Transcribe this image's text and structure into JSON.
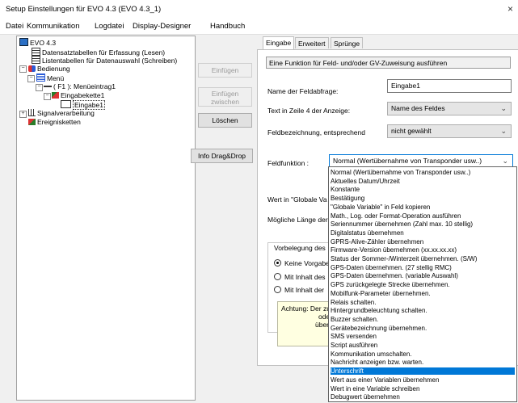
{
  "window": {
    "title": "Setup Einstellungen für EVO 4.3    (EVO 4.3_1)",
    "close_glyph": "×"
  },
  "menu": [
    "Datei",
    "Kommunikation",
    "Logdatei",
    "Display-Designer",
    "Handbuch"
  ],
  "tree": {
    "root": "EVO 4.3",
    "items": [
      "Datensatztabellen für Erfassung (Lesen)",
      "Listentabellen für Datenauswahl (Schreiben)",
      "Bedienung",
      "Menü",
      "( F1 ): Menüeintrag1",
      "Eingabekette1",
      "Eingabe1",
      "Signalverarbeitung",
      "Ereignisketten"
    ]
  },
  "buttons": {
    "einfuegen": "Einfügen",
    "einfuegen_zwischen": "Einfügen zwischen",
    "loeschen": "Löschen",
    "info_dragdrop": "Info Drag&Drop"
  },
  "tabs": [
    "Eingabe",
    "Erweitert",
    "Sprünge"
  ],
  "form": {
    "heading": "Eine Funktion für Feld- und/oder GV-Zuweisung ausführen",
    "name_label": "Name der Feldabfrage:",
    "name_value": "Eingabe1",
    "text_label": "Text in Zeile 4 der Anzeige:",
    "text_value": "Name des Feldes",
    "bez_label": "Feldbezeichnung, entsprechend",
    "bez_value": "nicht gewählt",
    "funktion_label": "Feldfunktion :",
    "funktion_value": "Normal (Wertübernahme von Transponder usw..)",
    "wert_label": "Wert in \"Globale Va",
    "laenge_label": "Mögliche Länge der",
    "vorbelegung_label": "Vorbelegung des",
    "radio1": "Keine Vorgabe",
    "radio2": "Mit Inhalt des",
    "radio3": "Mit Inhalt der",
    "note_lines": [
      "Achtung: Der zu",
      "oder d",
      "übersc"
    ]
  },
  "dropdown_options": [
    "Normal (Wertübernahme von Transponder usw..)",
    "Aktuelles Datum/Uhrzeit",
    "Konstante",
    "Bestätigung",
    "\"Globale Variable\" in Feld kopieren",
    "Math., Log. oder Format-Operation ausführen",
    "Seriennummer übernehmen (Zahl max. 10 stellig)",
    "Digitalstatus übernehmen",
    "GPRS-Alive-Zähler übernehmen",
    "Firmware-Version übernehmen (xx.xx.xx.xx)",
    "Status der Sommer-/Winterzeit übernehmen. (S/W)",
    "GPS-Daten übernehmen. (27 stellig RMC)",
    "GPS-Daten übernehmen. (variable Auswahl)",
    "GPS zurückgelegte Strecke übernehmen.",
    "Mobilfunk-Parameter übernehmen.",
    "Relais schalten.",
    "Hintergrundbeleuchtung schalten.",
    "Buzzer schalten.",
    "Gerätebezeichnung übernehmen.",
    "SMS versenden",
    "Script ausführen",
    "Kommunikation umschalten.",
    "Nachricht anzeigen bzw. warten.",
    "Unterschrift",
    "Wert aus einer Variablen übernehmen",
    "Wert in eine Variable schreiben",
    "Debugwert übernehmen"
  ],
  "dropdown_selected_index": 23,
  "colors": {
    "selection": "#0078d7",
    "note_bg": "#ffffe1"
  }
}
